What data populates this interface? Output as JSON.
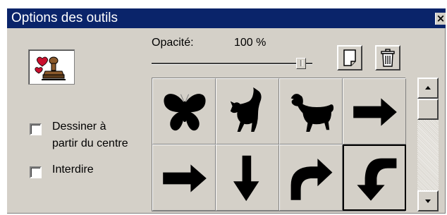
{
  "window": {
    "title": "Options des outils",
    "close_glyph": "×"
  },
  "tool": {
    "icon": "rubber-stamp-icon"
  },
  "opacity": {
    "label": "Opacité:",
    "value_text": "100 %",
    "value": 100
  },
  "toolbar": {
    "new_icon": "new-page-icon",
    "delete_icon": "trash-icon"
  },
  "options": {
    "draw_from_center_line1": "Dessiner à",
    "draw_from_center_line2": "partir du centre",
    "draw_from_center_checked": false,
    "forbid_label": "Interdire",
    "forbid_checked": false
  },
  "shapes": [
    {
      "name": "butterfly",
      "icon": "butterfly-icon",
      "selected": false
    },
    {
      "name": "cat",
      "icon": "cat-icon",
      "selected": false
    },
    {
      "name": "dog",
      "icon": "dog-icon",
      "selected": false
    },
    {
      "name": "arrow-right",
      "icon": "arrow-right-icon",
      "selected": false
    },
    {
      "name": "arrow-right-2",
      "icon": "arrow-right-icon",
      "selected": false
    },
    {
      "name": "arrow-down",
      "icon": "arrow-down-icon",
      "selected": false
    },
    {
      "name": "arrow-curve-right",
      "icon": "curved-arrow-right-icon",
      "selected": false
    },
    {
      "name": "arrow-curve-down",
      "icon": "curved-arrow-down-icon",
      "selected": true
    }
  ],
  "colors": {
    "titlebar": "#0a246a",
    "face": "#d4d0c8",
    "stamp_red": "#c8102e",
    "stamp_brown": "#8b5a2b"
  }
}
